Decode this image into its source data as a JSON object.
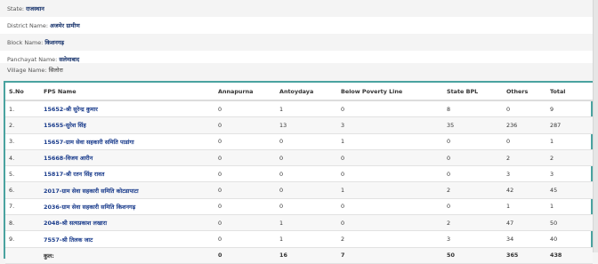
{
  "info": [
    {
      "label": "State:",
      "value": "राजस्थान"
    },
    {
      "label": "District Name:",
      "value": "अजमेर ग्रामीण"
    },
    {
      "label": "Block Name:",
      "value": "किशनगढ़"
    },
    {
      "label": "Panchayat Name:",
      "value": "सलेमाबाद"
    },
    {
      "label": "Village Name:",
      "value": "सिलोरा"
    }
  ],
  "table": {
    "headers": [
      "S.No",
      "FPS Name",
      "Annapurna",
      "Antoydaya",
      "Below Poverty Line",
      "State BPL",
      "Others",
      "Total"
    ],
    "rows": [
      [
        "1.",
        "15652-श्री सुरेन्द्र कुमार",
        "0",
        "1",
        "0",
        "8",
        "0",
        "9"
      ],
      [
        "2.",
        "15655-सुरेश सिंह",
        "0",
        "13",
        "3",
        "35",
        "236",
        "287"
      ],
      [
        "3.",
        "15657-ग्राम सेवा सहकारी समिति पाडांगा",
        "0",
        "0",
        "1",
        "0",
        "0",
        "1"
      ],
      [
        "4.",
        "15668-विजय आरीन",
        "0",
        "0",
        "0",
        "0",
        "2",
        "2"
      ],
      [
        "5.",
        "15817-श्री रतन सिंह रावत",
        "0",
        "0",
        "0",
        "0",
        "3",
        "3"
      ],
      [
        "6.",
        "2017-ग्राम सेवा सहकारी समिति कोटडापाटा",
        "0",
        "0",
        "1",
        "2",
        "42",
        "45"
      ],
      [
        "7.",
        "2036-ग्राम सेवा सहकारी समिति किशनगढ़",
        "0",
        "0",
        "0",
        "0",
        "1",
        "1"
      ],
      [
        "8.",
        "2048-श्री सत्यप्रकाश लखारा",
        "0",
        "1",
        "0",
        "2",
        "47",
        "50"
      ],
      [
        "9.",
        "7557-श्री तिलक जाट",
        "0",
        "1",
        "2",
        "3",
        "34",
        "40"
      ]
    ],
    "total": [
      "",
      "कुल:",
      "0",
      "16",
      "7",
      "50",
      "365",
      "438"
    ]
  }
}
